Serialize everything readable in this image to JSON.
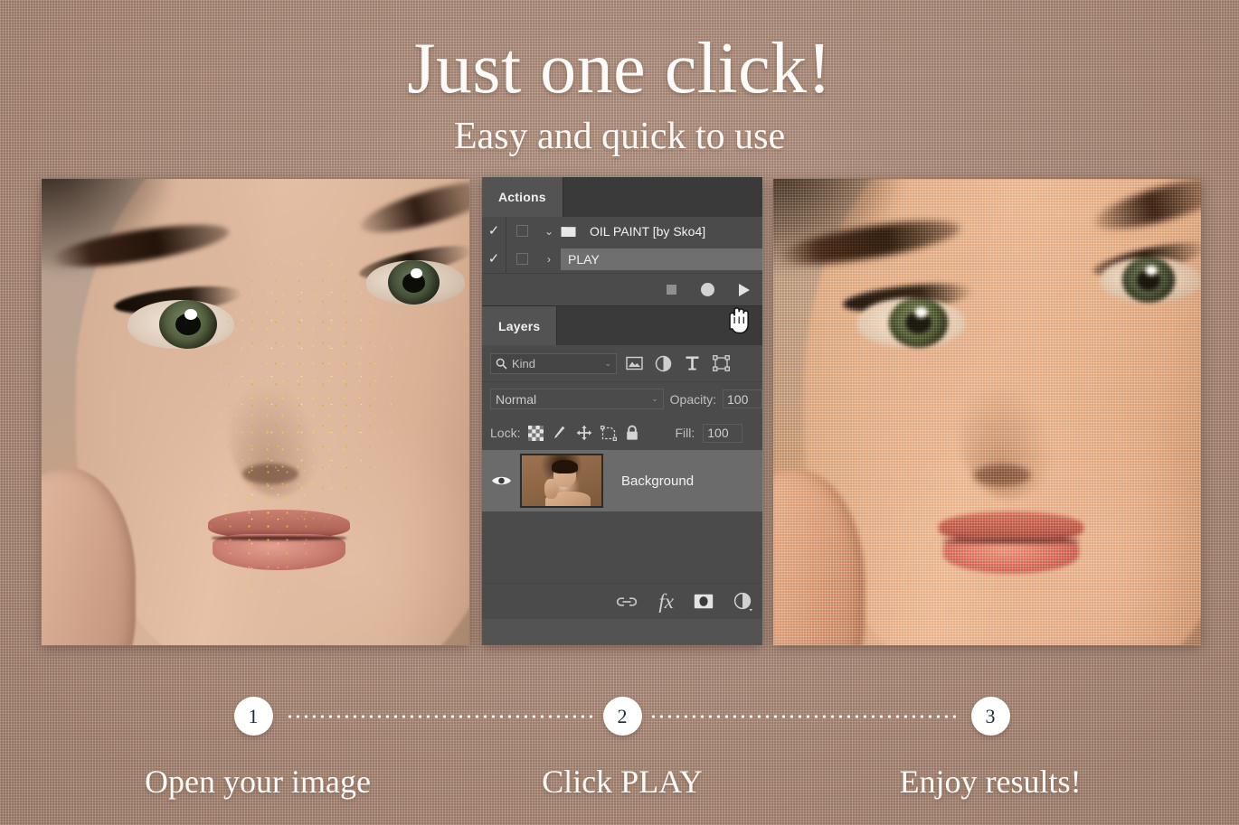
{
  "header": {
    "title": "Just one click!",
    "subtitle": "Easy and quick to use"
  },
  "colors": {
    "background": "#b3917f",
    "panel": "#535353",
    "panel_tab_inactive": "#3a3a3a",
    "panel_row": "#4b4b4b",
    "selected_row": "#6f6f6f",
    "text_light": "#f0f0f0",
    "step_circle": "#ffffff",
    "step_number": "#1f2b33"
  },
  "photos": {
    "before": {
      "name": "original-portrait",
      "alt": "Original portrait with gold glitter makeup"
    },
    "after": {
      "name": "oil-paint-portrait",
      "alt": "Portrait after oil paint action"
    }
  },
  "photoshop": {
    "actions_panel": {
      "tab_label": "Actions",
      "rows": [
        {
          "checked": "✓",
          "dialog": "",
          "arrow": "⌄",
          "icon": "folder-icon",
          "label": "OIL PAINT [by Sko4]",
          "selected": false
        },
        {
          "checked": "✓",
          "dialog": "",
          "arrow": "›",
          "icon": "",
          "label": "PLAY",
          "selected": true
        }
      ],
      "toolbar": [
        {
          "name": "stop-button",
          "label": "Stop"
        },
        {
          "name": "record-button",
          "label": "Record"
        },
        {
          "name": "play-button",
          "label": "Play"
        }
      ]
    },
    "layers_panel": {
      "tab_label": "Layers",
      "filter": {
        "kind_label": "Kind",
        "search_icon": "search-icon",
        "caret": "⌄",
        "icons": [
          "image-filter-icon",
          "adjustment-filter-icon",
          "type-filter-icon",
          "shape-filter-icon"
        ]
      },
      "blend": {
        "mode": "Normal",
        "caret": "⌄",
        "opacity_label": "Opacity:",
        "opacity_value": "100"
      },
      "lock": {
        "label": "Lock:",
        "icons": [
          "lock-transparency-icon",
          "lock-image-icon",
          "lock-position-icon",
          "lock-artboard-icon",
          "lock-all-icon"
        ],
        "fill_label": "Fill:",
        "fill_value": "100"
      },
      "layers": [
        {
          "visible": true,
          "name": "Background",
          "thumbnail": "portrait-thumbnail",
          "selected": true
        }
      ],
      "toolbar": [
        {
          "name": "link-layers-icon",
          "label": "Link layers"
        },
        {
          "name": "layer-style-icon",
          "label": "fx"
        },
        {
          "name": "layer-mask-icon",
          "label": "Add layer mask"
        },
        {
          "name": "adjustment-layer-icon",
          "label": "New adjustment layer"
        }
      ]
    },
    "cursor": "hand-cursor"
  },
  "steps": [
    {
      "number": "1",
      "label": "Open your image"
    },
    {
      "number": "2",
      "label": "Click PLAY"
    },
    {
      "number": "3",
      "label": "Enjoy results!"
    }
  ]
}
